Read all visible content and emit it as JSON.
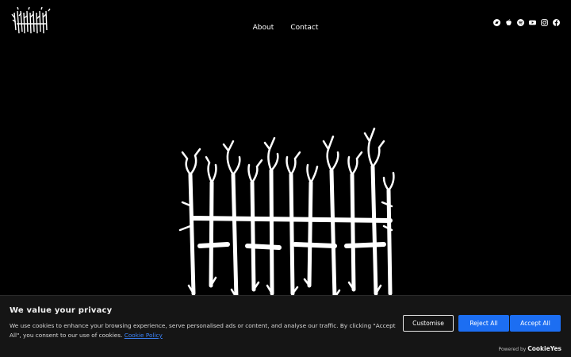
{
  "header": {
    "logo_alt": "ASKEFRON",
    "nav": [
      {
        "label": "About"
      },
      {
        "label": "Contact"
      }
    ],
    "social_icons": [
      "bandcamp-icon",
      "apple-music-icon",
      "spotify-icon",
      "youtube-icon",
      "instagram-icon",
      "facebook-icon"
    ]
  },
  "hero": {
    "logo_text": "ASKEFRON"
  },
  "cookie_banner": {
    "title": "We value your privacy",
    "text": "We use cookies to enhance your browsing experience, serve personalised ads or content, and analyse our traffic. By clicking \"Accept All\", you consent to our use of cookies.",
    "policy_link": "Cookie Policy",
    "buttons": {
      "customise": "Customise",
      "reject": "Reject All",
      "accept": "Accept All"
    },
    "powered_by": "Powered by",
    "brand": "CookieYes"
  },
  "colors": {
    "background": "#000000",
    "banner_bg": "#151515",
    "accent": "#1c6ef2",
    "link": "#3b82f6"
  }
}
